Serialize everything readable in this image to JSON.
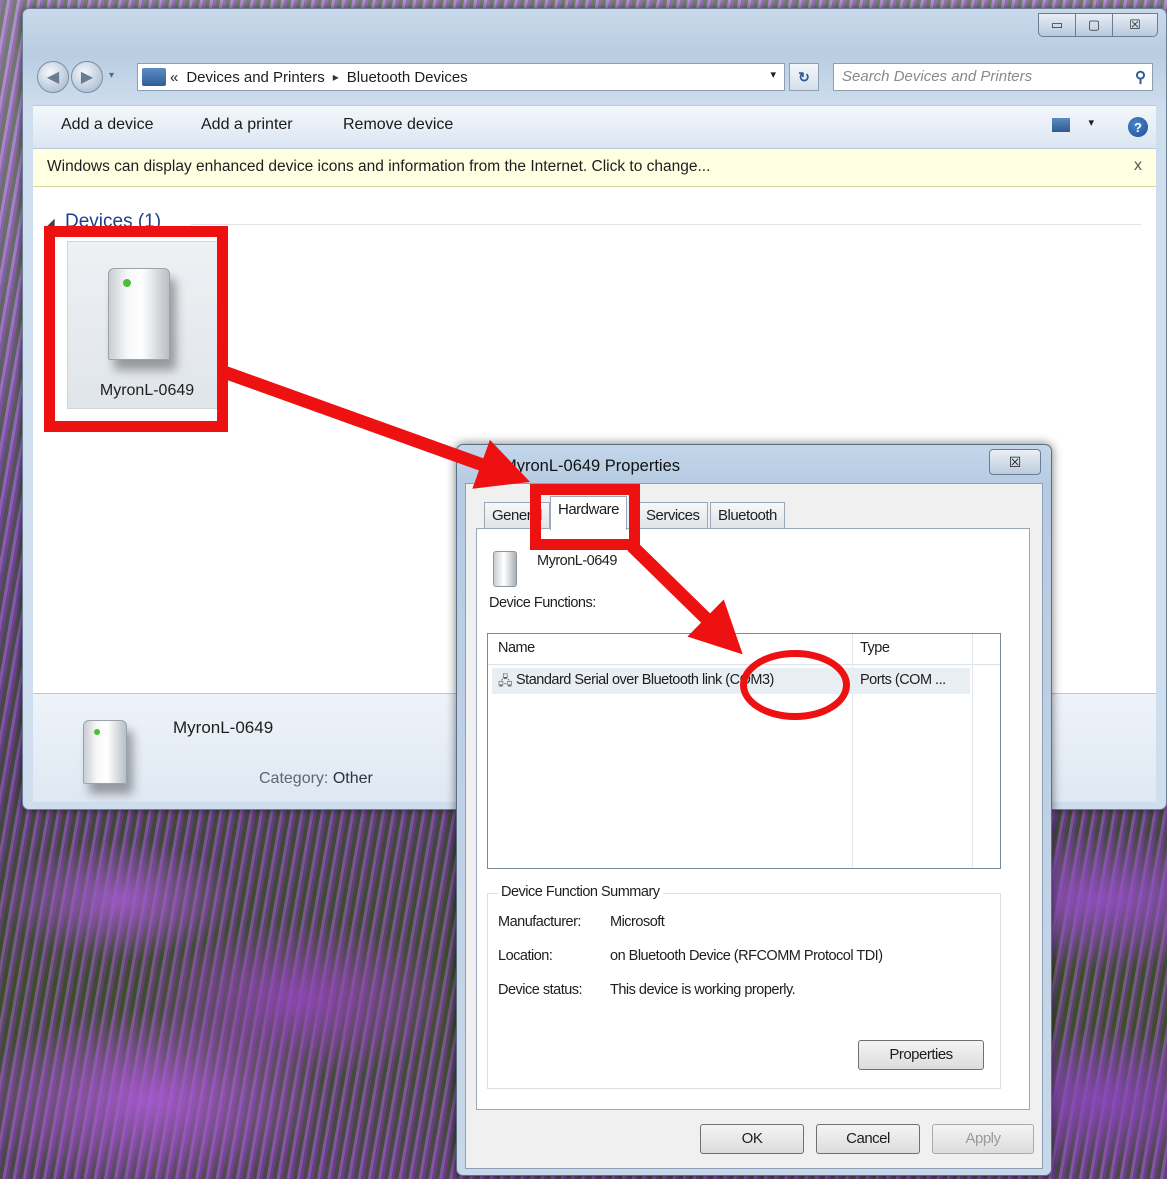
{
  "explorer": {
    "window_controls": {
      "minimize": "▭",
      "maximize": "▢",
      "close": "☒"
    },
    "address": {
      "overflow": "«",
      "crumbs": [
        "Devices and Printers",
        "Bluetooth Devices"
      ],
      "separator": "▸",
      "dropdown": "▾"
    },
    "search_placeholder": "Search Devices and Printers",
    "toolbar": {
      "add_device": "Add a device",
      "add_printer": "Add a printer",
      "remove_device": "Remove device"
    },
    "infobar": {
      "text": "Windows can display enhanced device icons and information from the Internet. Click to change...",
      "close": "x"
    },
    "group": {
      "title": "Devices (1)"
    },
    "device": {
      "name": "MyronL-0649"
    },
    "details": {
      "name": "MyronL-0649",
      "category_label": "Category:",
      "category_value": "Other"
    }
  },
  "dialog": {
    "title": "MyronL-0649 Properties",
    "close": "☒",
    "tabs": [
      "General",
      "Hardware",
      "Services",
      "Bluetooth"
    ],
    "device_name": "MyronL-0649",
    "functions_label": "Device Functions:",
    "columns": [
      "Name",
      "Type"
    ],
    "rows": [
      {
        "name": "Standard Serial over Bluetooth link (COM3)",
        "type": "Ports (COM ..."
      }
    ],
    "summary": {
      "title": "Device Function Summary",
      "manufacturer_label": "Manufacturer:",
      "manufacturer": "Microsoft",
      "location_label": "Location:",
      "location": "on Bluetooth Device (RFCOMM Protocol TDI)",
      "status_label": "Device status:",
      "status": "This device is working properly."
    },
    "buttons": {
      "properties": "Properties",
      "ok": "OK",
      "cancel": "Cancel",
      "apply": "Apply"
    }
  },
  "annotation_color": "#ee1111"
}
